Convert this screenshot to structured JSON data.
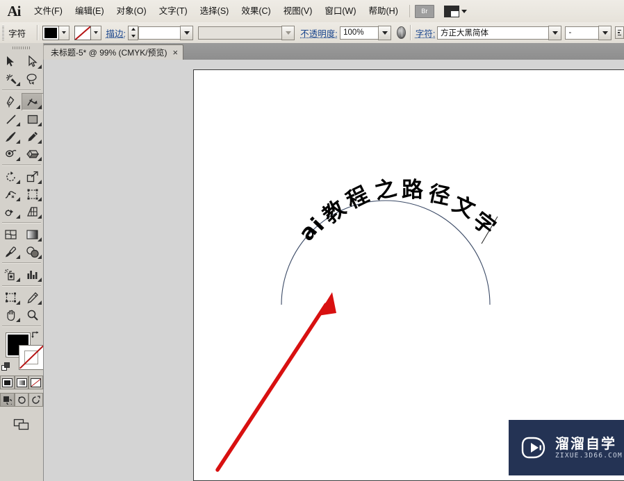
{
  "app": {
    "name": "Ai",
    "logo_text": "Ai"
  },
  "menubar": {
    "items": [
      {
        "label": "文件(F)",
        "name": "menu-file"
      },
      {
        "label": "编辑(E)",
        "name": "menu-edit"
      },
      {
        "label": "对象(O)",
        "name": "menu-object"
      },
      {
        "label": "文字(T)",
        "name": "menu-type"
      },
      {
        "label": "选择(S)",
        "name": "menu-select"
      },
      {
        "label": "效果(C)",
        "name": "menu-effect"
      },
      {
        "label": "视图(V)",
        "name": "menu-view"
      },
      {
        "label": "窗口(W)",
        "name": "menu-window"
      },
      {
        "label": "帮助(H)",
        "name": "menu-help"
      }
    ],
    "bridge_label": "Br",
    "arrange_icon": "arrange-documents-icon"
  },
  "controlbar": {
    "char_label": "字符",
    "fill_color": "#000000",
    "stroke_color": "none",
    "stroke_label": "描边:",
    "stroke_weight": "",
    "brush_value": "",
    "opacity_label": "不透明度:",
    "opacity_value": "100%",
    "style_icon": "graphic-style-icon",
    "font_label": "字符:",
    "font_family": "方正大黑简体",
    "font_style": "-",
    "options_icon": "panel-options-icon"
  },
  "tab": {
    "title": "未标题-5* @ 99% (CMYK/预览)",
    "close": "×"
  },
  "toolbar": {
    "tools": [
      {
        "name": "selection-tool",
        "label": "选择工具",
        "selected": false
      },
      {
        "name": "direct-selection-tool",
        "label": "直接选择工具",
        "selected": false
      },
      {
        "name": "magic-wand-tool",
        "label": "魔棒工具",
        "selected": false
      },
      {
        "name": "lasso-tool",
        "label": "套索工具",
        "selected": false
      },
      {
        "name": "pen-tool",
        "label": "钢笔工具",
        "selected": false
      },
      {
        "name": "type-tool",
        "label": "文字工具",
        "selected": true
      },
      {
        "name": "line-segment-tool",
        "label": "直线段工具",
        "selected": false
      },
      {
        "name": "rectangle-tool",
        "label": "矩形工具",
        "selected": false
      },
      {
        "name": "paintbrush-tool",
        "label": "画笔工具",
        "selected": false
      },
      {
        "name": "pencil-tool",
        "label": "铅笔工具",
        "selected": false
      },
      {
        "name": "blob-brush-tool",
        "label": "斑点画笔工具",
        "selected": false
      },
      {
        "name": "eraser-tool",
        "label": "橡皮擦工具",
        "selected": false
      },
      {
        "name": "rotate-tool",
        "label": "旋转工具",
        "selected": false
      },
      {
        "name": "scale-tool",
        "label": "比例缩放工具",
        "selected": false
      },
      {
        "name": "width-tool",
        "label": "宽度工具",
        "selected": false
      },
      {
        "name": "free-transform-tool",
        "label": "自由变换工具",
        "selected": false
      },
      {
        "name": "shape-builder-tool",
        "label": "形状生成器工具",
        "selected": false
      },
      {
        "name": "perspective-grid-tool",
        "label": "透视网格工具",
        "selected": false
      },
      {
        "name": "mesh-tool",
        "label": "网格工具",
        "selected": false
      },
      {
        "name": "gradient-tool",
        "label": "渐变工具",
        "selected": false
      },
      {
        "name": "eyedropper-tool",
        "label": "吸管工具",
        "selected": false
      },
      {
        "name": "blend-tool",
        "label": "混合工具",
        "selected": false
      },
      {
        "name": "symbol-sprayer-tool",
        "label": "符号喷枪工具",
        "selected": false
      },
      {
        "name": "column-graph-tool",
        "label": "柱形图工具",
        "selected": false
      },
      {
        "name": "artboard-tool",
        "label": "画板工具",
        "selected": false
      },
      {
        "name": "slice-tool",
        "label": "切片工具",
        "selected": false
      },
      {
        "name": "hand-tool",
        "label": "抓手工具",
        "selected": false
      },
      {
        "name": "zoom-tool",
        "label": "缩放工具",
        "selected": false
      }
    ],
    "fill_color": "#000000",
    "stroke_color": "none",
    "swap_icon": "swap-fill-stroke-icon",
    "default_icon": "default-fill-stroke-icon",
    "paint_modes": [
      {
        "name": "color-mode-button",
        "kind": "solid",
        "on": false
      },
      {
        "name": "gradient-mode-button",
        "kind": "gradient",
        "on": false
      },
      {
        "name": "none-mode-button",
        "kind": "none",
        "on": false
      }
    ],
    "screen_modes": [
      {
        "name": "normal-screen-mode-button",
        "on": true
      },
      {
        "name": "fullscreen-menubar-mode-button",
        "on": false
      },
      {
        "name": "fullscreen-mode-button",
        "on": false
      }
    ],
    "change_screen_icon": "change-screen-mode-icon"
  },
  "artwork": {
    "path_text": "ai教程之路径文字",
    "path_text_chars": [
      "a",
      "i",
      "教",
      "程",
      "之",
      "路",
      "径",
      "文",
      "字"
    ],
    "path_stroke_color": "#3b4a66",
    "annotation_arrow_color": "#d81010",
    "annotation_name": "red-pointer-arrow"
  },
  "watermark": {
    "brand_cn": "溜溜自学",
    "brand_url": "ZIXUE.3D66.COM",
    "bg_color": "#243354",
    "logo_icon": "play-button-logo-icon"
  }
}
